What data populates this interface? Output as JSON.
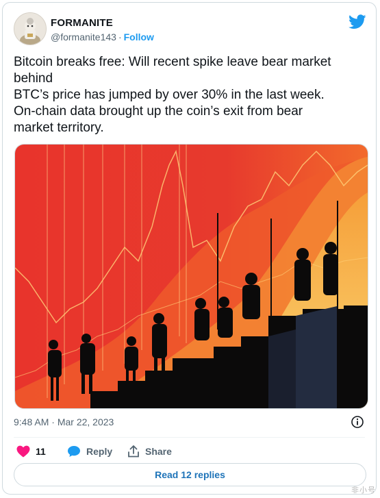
{
  "user": {
    "name": "FORMANITE",
    "handle": "@formanite143",
    "separator": "·",
    "follow_label": "Follow"
  },
  "tweet": {
    "lines": [
      "Bitcoin breaks free: Will recent spike leave bear market",
      "behind",
      "BTC’s price has jumped by over 30% in the last week.",
      "On-chain data brought up the coin’s exit from bear",
      "market territory."
    ],
    "time": "9:48 AM",
    "date_separator": "·",
    "date": "Mar 22, 2023"
  },
  "actions": {
    "like_count": "11",
    "reply_label": "Reply",
    "share_label": "Share",
    "read_replies_label": "Read 12 replies"
  },
  "watermark": "非小号",
  "colors": {
    "accent": "#1d9bf0",
    "heart": "#f91880",
    "text": "#0f1419",
    "muted": "#536471"
  },
  "icons": {
    "brand": "twitter-bird-icon",
    "like": "heart-icon",
    "reply": "speech-bubble-icon",
    "share": "share-upload-icon",
    "info": "info-icon"
  }
}
